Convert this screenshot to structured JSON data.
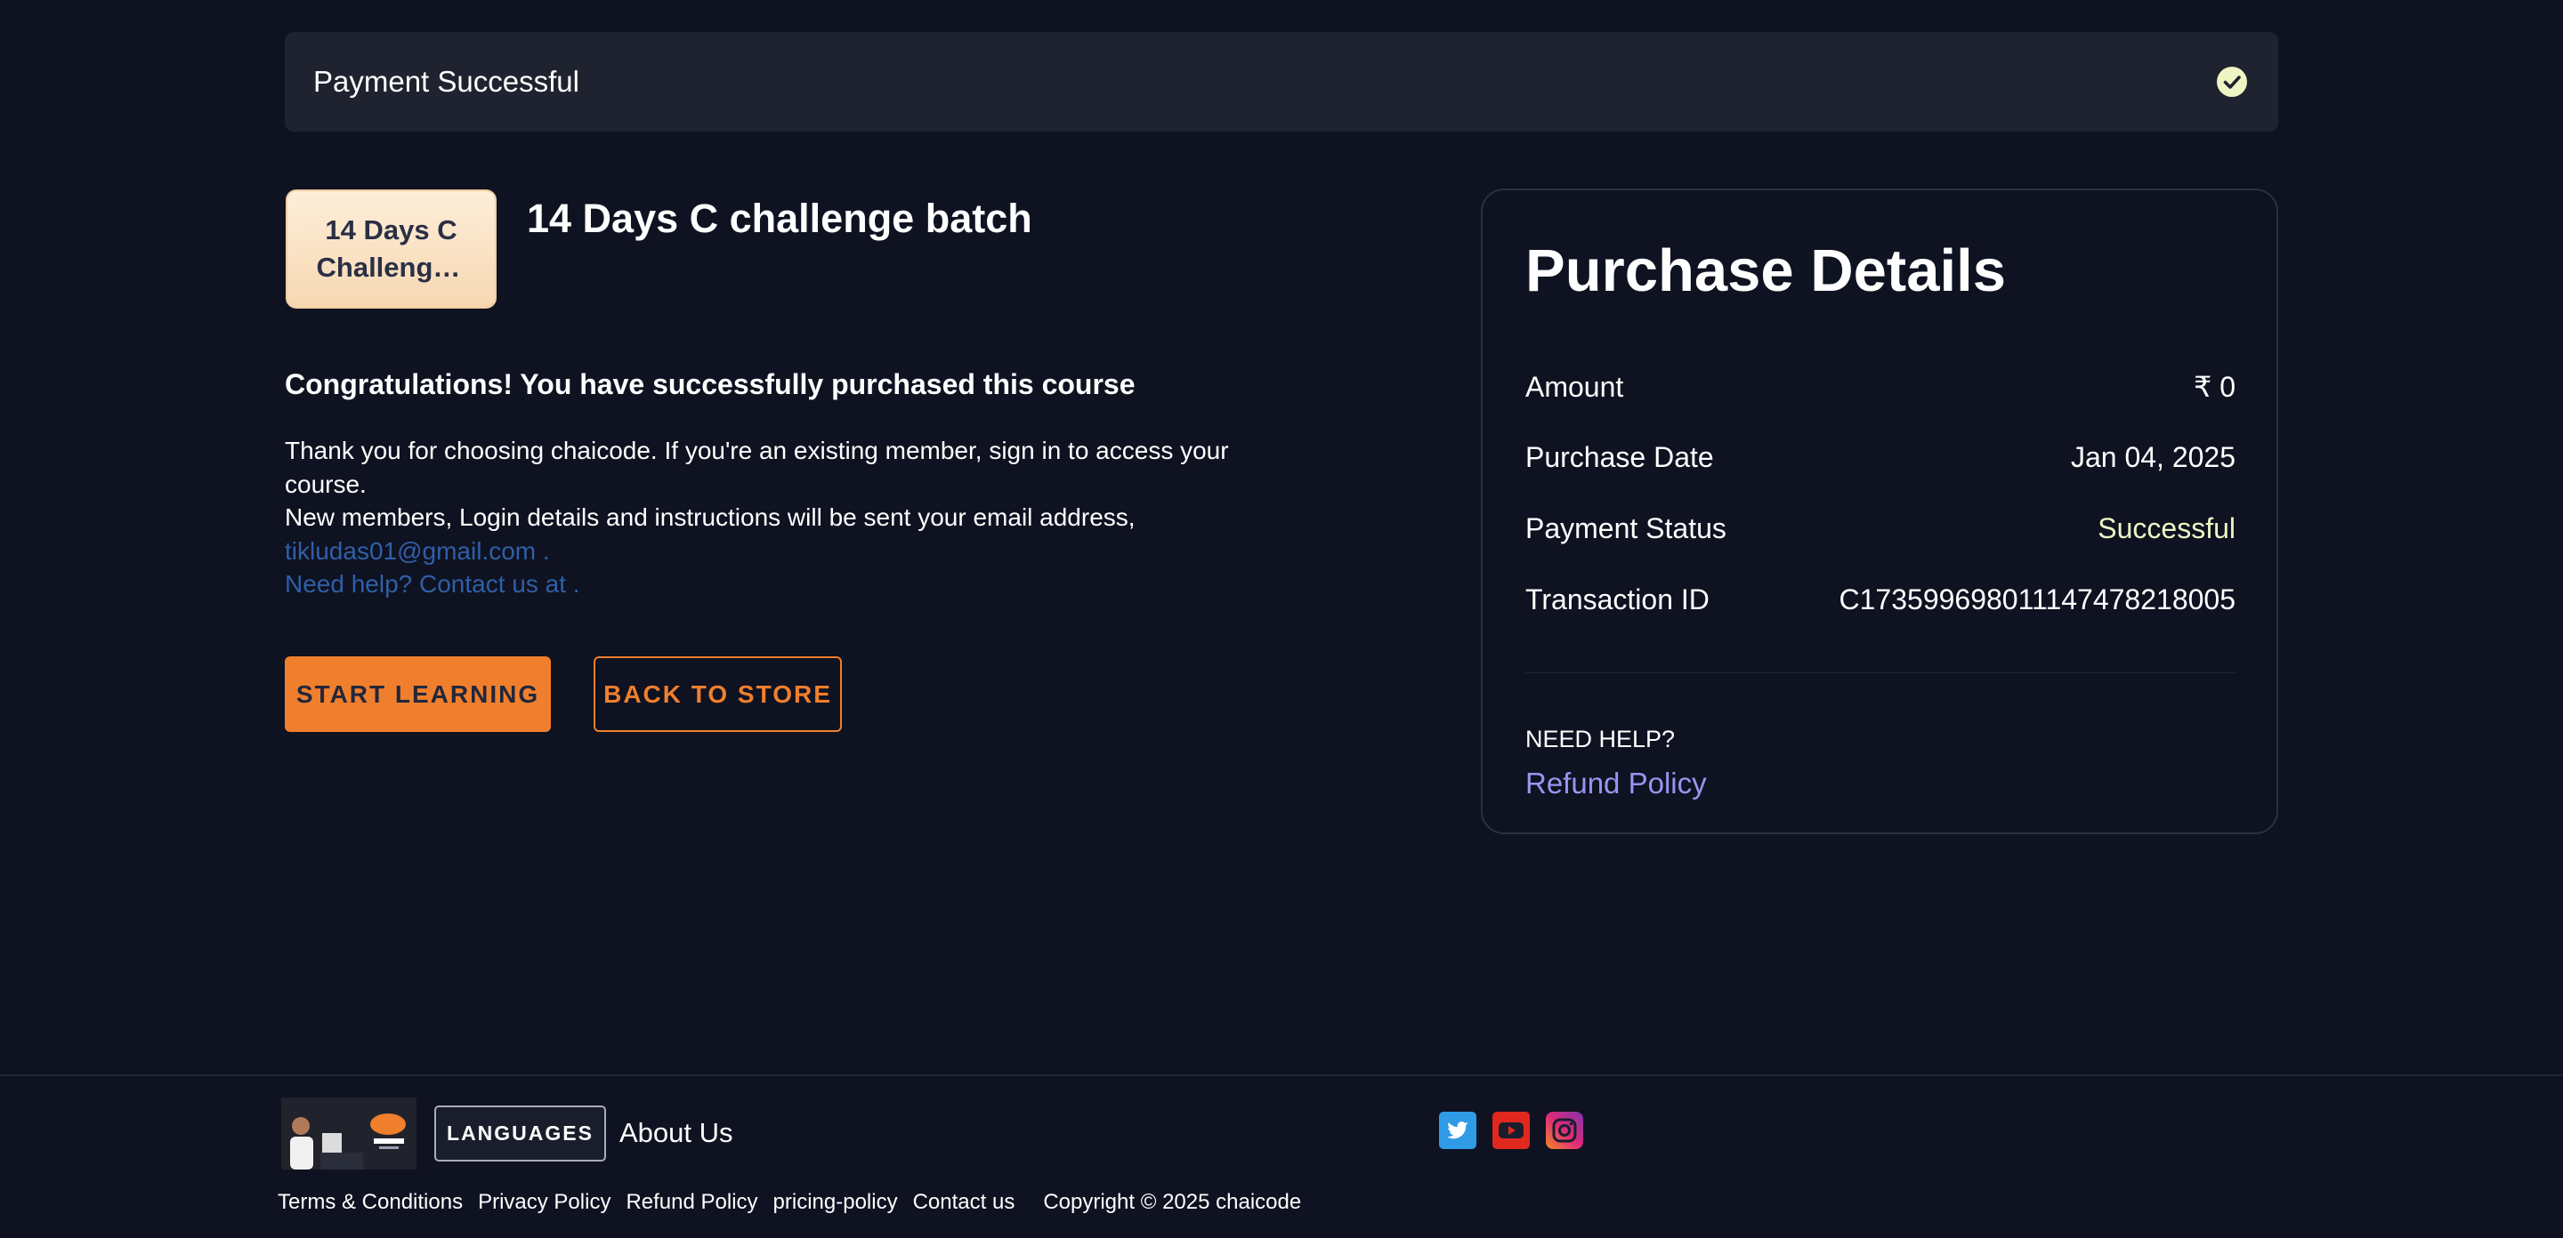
{
  "banner": {
    "title": "Payment Successful",
    "icon": "check-circle-icon"
  },
  "course": {
    "thumbnail_line1": "14 Days C",
    "thumbnail_line2": "Challenge...",
    "title": "14 Days C challenge batch"
  },
  "message": {
    "heading": "Congratulations! You have successfully purchased this course",
    "line1": "Thank you for choosing chaicode.  If you're an existing member, sign in to access your",
    "line2": "course.",
    "line3": "New members, Login details and instructions will be sent your email address,",
    "email": "tikludas01@gmail.com .",
    "help": "Need help? Contact us at ."
  },
  "actions": {
    "start_label": "START LEARNING",
    "back_label": "BACK TO STORE"
  },
  "purchase": {
    "title": "Purchase Details",
    "rows": [
      {
        "label": "Amount",
        "value": "₹ 0"
      },
      {
        "label": "Purchase Date",
        "value": "Jan 04, 2025"
      },
      {
        "label": "Payment Status",
        "value": "Successful"
      },
      {
        "label": "Transaction ID",
        "value": "C1735996980111474782180​05"
      }
    ],
    "need_help": "NEED HELP?",
    "refund_link": "Refund Policy"
  },
  "footer": {
    "logo": "chaicode-logo",
    "languages_label": "LANGUAGES",
    "about_label": "About Us",
    "social_icons": [
      "twitter-icon",
      "youtube-icon",
      "instagram-icon"
    ],
    "links": [
      "Terms & Conditions",
      "Privacy Policy",
      "Refund Policy",
      "pricing-policy",
      "Contact us"
    ],
    "copyright": "Copyright © 2025 chaicode"
  },
  "colors": {
    "background": "#0f1221",
    "accent": "#f07f2d",
    "success": "#eef5c3",
    "link": "#2f5fa8",
    "refund": "#9a94f0"
  }
}
